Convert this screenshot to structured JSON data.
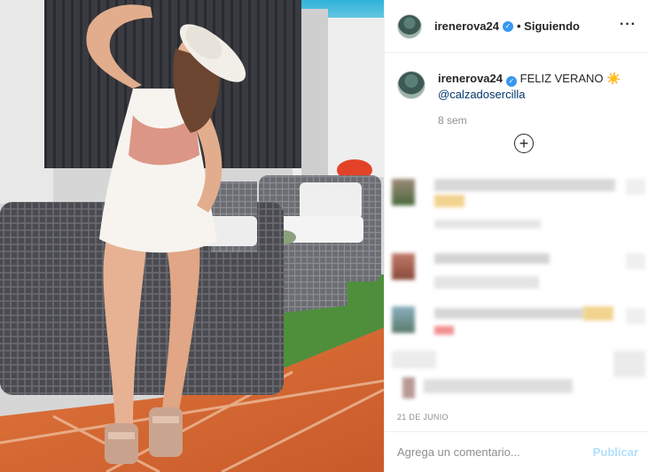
{
  "post": {
    "username": "irenerova24",
    "follow_status": "• Siguiendo",
    "more_icon": "more-options-icon",
    "caption_text": "FELIZ VERANO ☀️",
    "caption_mention": "@calzadosercilla",
    "time_ago": "8 sem",
    "load_more_icon": "plus-circle-icon",
    "date": "21 DE JUNIO"
  },
  "comment_box": {
    "placeholder": "Agrega un comentario...",
    "publish_label": "Publicar"
  },
  "colors": {
    "link": "#00376b",
    "verified": "#3897f0",
    "publish_disabled": "#b2dffc",
    "muted": "#8e8e8e"
  }
}
